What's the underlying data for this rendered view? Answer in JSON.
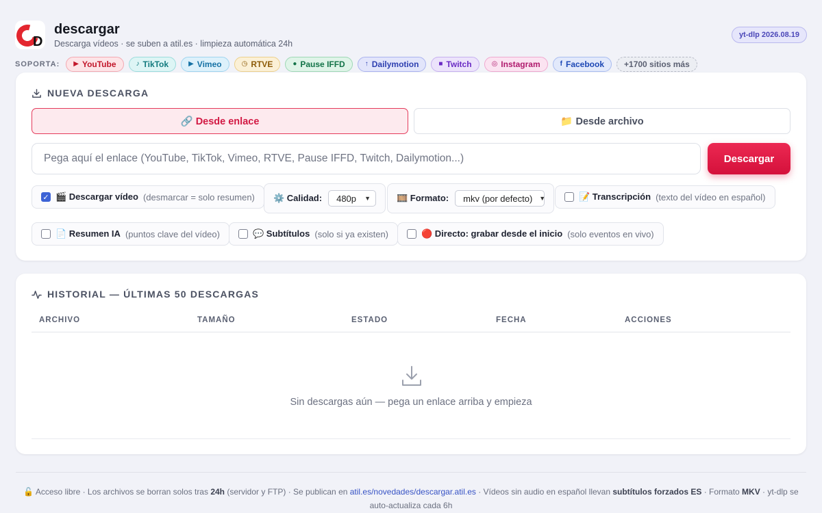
{
  "header": {
    "title": "descargar",
    "subtitle": "Descarga vídeos · se suben a atil.es · limpieza automática 24h",
    "version": "yt-dlp 2026.08.19",
    "logo_letter": "D"
  },
  "supports": {
    "label": "SOPORTA:",
    "chips": [
      {
        "label": "YouTube",
        "icon": "▶"
      },
      {
        "label": "TikTok",
        "icon": "♪"
      },
      {
        "label": "Vimeo",
        "icon": "▶"
      },
      {
        "label": "RTVE",
        "icon": "◷"
      },
      {
        "label": "Pause IFFD",
        "icon": "●"
      },
      {
        "label": "Dailymotion",
        "icon": "↑"
      },
      {
        "label": "Twitch",
        "icon": "■"
      },
      {
        "label": "Instagram",
        "icon": "◎"
      },
      {
        "label": "Facebook",
        "icon": "f"
      },
      {
        "label": "+1700 sitios más",
        "icon": ""
      }
    ]
  },
  "new_download": {
    "heading": "NUEVA DESCARGA",
    "mode_link": "🔗 Desde enlace",
    "mode_file": "📁 Desde archivo",
    "url_placeholder": "Pega aquí el enlace (YouTube, TikTok, Vimeo, RTVE, Pause IFFD, Twitch, Dailymotion...)",
    "url_value": "",
    "submit": "Descargar",
    "options": {
      "video": {
        "label": "🎬 Descargar vídeo",
        "hint": "(desmarcar = solo resumen)",
        "checked": true
      },
      "quality": {
        "label": "⚙️ Calidad:",
        "value": "480p"
      },
      "format": {
        "label": "🎞️ Formato:",
        "value": "mkv (por defecto)"
      },
      "transcript": {
        "label": "📝 Transcripción",
        "hint": "(texto del vídeo en español)",
        "checked": false
      },
      "summary": {
        "label": "📄 Resumen IA",
        "hint": "(puntos clave del vídeo)",
        "checked": false
      },
      "subtitles": {
        "label": "💬 Subtítulos",
        "hint": "(solo si ya existen)",
        "checked": false
      },
      "live": {
        "label": "🔴 Directo: grabar desde el inicio",
        "hint": "(solo eventos en vivo)",
        "checked": false
      }
    }
  },
  "history": {
    "heading": "HISTORIAL — ÚLTIMAS 50 DESCARGAS",
    "columns": [
      "ARCHIVO",
      "TAMAÑO",
      "ESTADO",
      "FECHA",
      "ACCIONES"
    ],
    "rows": [],
    "empty": "Sin descargas aún — pega un enlace arriba y empieza"
  },
  "footer": {
    "p1": "🔓 Acceso libre · Los archivos se borran solos tras ",
    "b1": "24h",
    "p2": " (servidor y FTP) · Se publican en ",
    "link": "atil.es/novedades/descargar.atil.es",
    "p3": " · Vídeos sin audio en español llevan ",
    "b2": "subtítulos forzados ES",
    "p4": " · Formato ",
    "b3": "MKV",
    "p5": " · yt-dlp se auto-actualiza cada 6h"
  },
  "colors": {
    "accent": "#d4113b",
    "brand": "#e3262f",
    "checkbox": "#3d63d6"
  }
}
